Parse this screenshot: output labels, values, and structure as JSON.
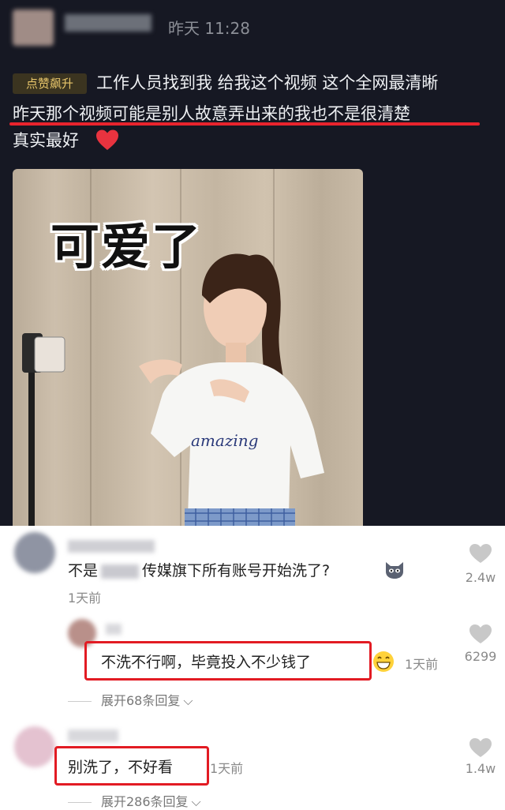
{
  "post": {
    "time": "昨天 11:28",
    "badge": "点赞飙升",
    "line1": "工作人员找到我 给我这个视频 这个全网最清晰",
    "line2": "昨天那个视频可能是别人故意弄出来的我也不是很清楚",
    "line3": "真实最好",
    "video_caption": "可爱了",
    "shirt_text": "amazing"
  },
  "comments": [
    {
      "text_before": "不是",
      "text_after": "传媒旗下所有账号开始洗了?",
      "time": "1天前",
      "likes": "2.4w",
      "icon": "cat-emoji-icon"
    },
    {
      "text": "不洗不行啊，毕竟投入不少钱了",
      "time": "1天前",
      "likes": "6299",
      "replies": "展开68条回复",
      "icon": "grin-emoji-icon"
    },
    {
      "text": "别洗了，不好看",
      "time": "1天前",
      "likes": "1.4w",
      "replies": "展开286条回复"
    }
  ],
  "colors": {
    "highlight": "#e21b23",
    "background_dark": "#161823",
    "badge_text": "#e7c56a"
  }
}
